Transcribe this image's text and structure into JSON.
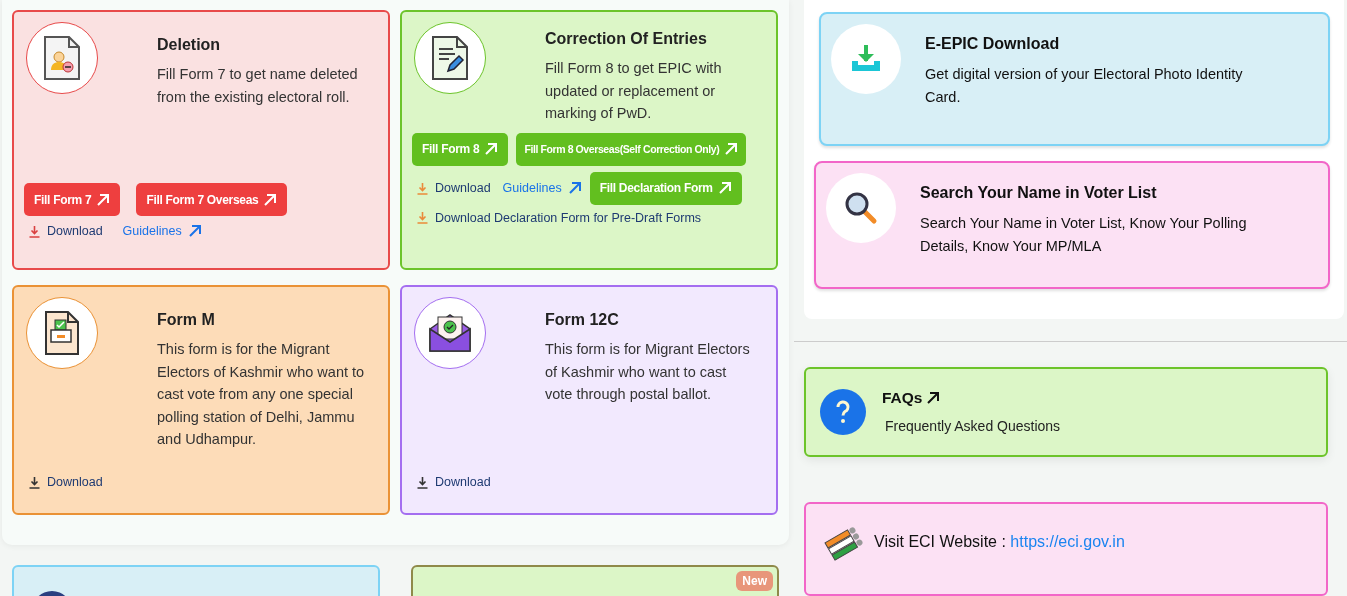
{
  "form_cards": [
    {
      "title": "Deletion",
      "description": "Fill Form 7 to get name deleted from the existing electoral roll.",
      "color": "#e84a4a",
      "actions": [
        {
          "kind": "button",
          "label": "Fill Form 7"
        },
        {
          "kind": "button",
          "label": "Fill Form 7 Overseas"
        },
        {
          "kind": "download",
          "label": "Download"
        },
        {
          "kind": "link",
          "label": "Guidelines"
        }
      ]
    },
    {
      "title": "Correction Of Entries",
      "description": "Fill Form 8 to get EPIC with updated or replacement or marking of PwD.",
      "color": "#6cc42a",
      "actions": [
        {
          "kind": "button",
          "label": "Fill Form 8"
        },
        {
          "kind": "button",
          "label": "Fill Form 8 Overseas(Self Correction Only)"
        },
        {
          "kind": "download",
          "label": "Download"
        },
        {
          "kind": "link",
          "label": "Guidelines"
        },
        {
          "kind": "button",
          "label": "Fill Declaration Form"
        },
        {
          "kind": "download",
          "label": "Download Declaration Form for Pre-Draft Forms"
        }
      ]
    },
    {
      "title": "Form M",
      "description": "This form is for the Migrant Electors of Kashmir who want to cast vote from any one special polling station of Delhi, Jammu and Udhampur.",
      "color": "#ea9236",
      "actions": [
        {
          "kind": "download",
          "label": "Download"
        }
      ]
    },
    {
      "title": "Form 12C",
      "description": "This form is for Migrant Electors of Kashmir who want to cast vote through postal ballot.",
      "color": "#a46ef0",
      "actions": [
        {
          "kind": "download",
          "label": "Download"
        }
      ]
    }
  ],
  "lower_cards": [
    {
      "color": "#7dd3f5"
    },
    {
      "color": "#8f8a4a",
      "badge": "New"
    }
  ],
  "service_cards": [
    {
      "title": "E-EPIC Download",
      "description": "Get digital version of your Electoral Photo Identity Card.",
      "color": "#7dd3f5"
    },
    {
      "title": "Search Your Name in Voter List",
      "description": "Search Your Name in Voter List, Know Your Polling Details, Know Your MP/MLA",
      "color": "#f266c8"
    }
  ],
  "faq": {
    "title": "FAQs",
    "description": "Frequently Asked Questions"
  },
  "eci": {
    "label": "Visit ECI Website :",
    "link": "https://eci.gov.in"
  }
}
